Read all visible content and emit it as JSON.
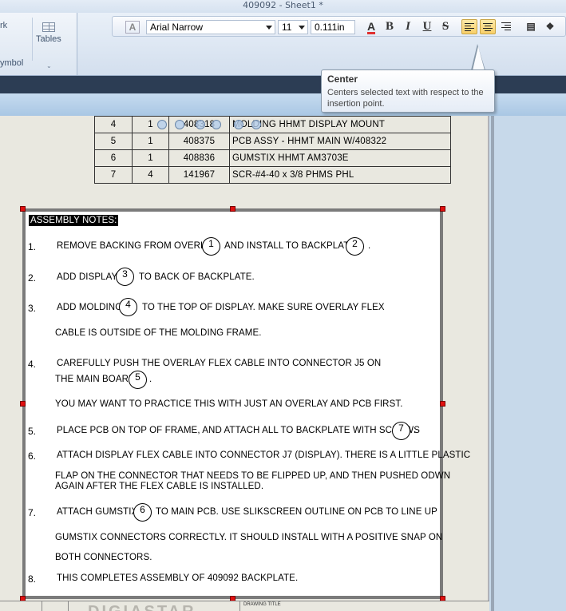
{
  "window": {
    "title": "409092 - Sheet1 *"
  },
  "ribbon": {
    "partial_top_label": "rk",
    "partial_bottom_label": "ymbol",
    "tables_label": "Tables"
  },
  "format_toolbar": {
    "font_name": "Arial Narrow",
    "font_size": "11",
    "line_spacing": "0.111in",
    "bold": "B",
    "italic": "I",
    "underline": "U",
    "strike": "S",
    "font_color_glyph": "A",
    "active_alignment": "center"
  },
  "tooltip": {
    "title": "Center",
    "description": "Centers selected text with respect to the insertion point."
  },
  "bom_rows": [
    {
      "item": "4",
      "qty": "1",
      "part": "408318",
      "desc": "MOLDING HHMT DISPLAY MOUNT"
    },
    {
      "item": "5",
      "qty": "1",
      "part": "408375",
      "desc": "PCB ASSY - HHMT MAIN W/408322"
    },
    {
      "item": "6",
      "qty": "1",
      "part": "408836",
      "desc": "GUMSTIX HHMT AM3703E"
    },
    {
      "item": "7",
      "qty": "4",
      "part": "141967",
      "desc": "SCR-#4-40 x 3/8 PHMS PHL"
    }
  ],
  "notes": {
    "heading": "ASSEMBLY NOTES:",
    "n1": "1.",
    "n1_a": "REMOVE BACKING FROM OVERLAY",
    "n1_b": "AND INSTALL TO BACKPLATE",
    "n1_end": ".",
    "n1_b1": "1",
    "n1_b2": "2",
    "n2": "2.",
    "n2_a": "ADD DISPLAY",
    "n2_b": "TO BACK OF BACKPLATE.",
    "n2_b1": "3",
    "n3": "3.",
    "n3_a": "ADD MOLDING",
    "n3_b": "TO THE TOP OF DISPLAY. MAKE SURE OVERLAY FLEX",
    "n3_c": "CABLE IS OUTSIDE OF THE MOLDING FRAME.",
    "n3_b1": "4",
    "n4": "4.",
    "n4_a": "CAREFULLY PUSH THE OVERLAY FLEX CABLE INTO CONNECTOR J5 ON",
    "n4_b": "THE MAIN BOARD",
    "n4_end": ".",
    "n4_b1": "5",
    "n4_c": "YOU MAY WANT TO PRACTICE THIS WITH JUST AN OVERLAY AND PCB FIRST.",
    "n5": "5.",
    "n5_a": "PLACE PCB ON TOP OF FRAME, AND ATTACH  ALL TO BACKPLATE WITH SCREWS",
    "n5_end": ".",
    "n5_b1": "7",
    "n6": "6.",
    "n6_a": "ATTACH DISPLAY FLEX CABLE INTO CONNECTOR J7 (DISPLAY). THERE IS A LITTLE PLASTIC",
    "n6_b": "FLAP ON THE CONNECTOR THAT NEEDS TO BE FLIPPED UP, AND THEN PUSHED ODWN",
    "n6_c": "AGAIN AFTER THE FLEX CABLE IS INSTALLED.",
    "n7": "7.",
    "n7_a": "ATTACH GUMSTIX",
    "n7_b": "TO MAIN PCB. USE SLIKSCREEN OUTLINE ON PCB TO LINE UP",
    "n7_b1": "6",
    "n7_c": "GUMSTIX CONNECTORS CORRECTLY. IT SHOULD INSTALL WITH A POSITIVE SNAP ON",
    "n7_d": "BOTH CONNECTORS.",
    "n8": "8.",
    "n8_a": "THIS COMPLETES ASSEMBLY OF 409092 BACKPLATE."
  },
  "title_block": {
    "logo_text": "DIGIASTAR",
    "drawing_title_label": "DRAWING TITLE"
  },
  "colors": {
    "selection_handle": "#e01010",
    "accent_dark": "#2c3d54",
    "active_button": "#f8cf69"
  }
}
